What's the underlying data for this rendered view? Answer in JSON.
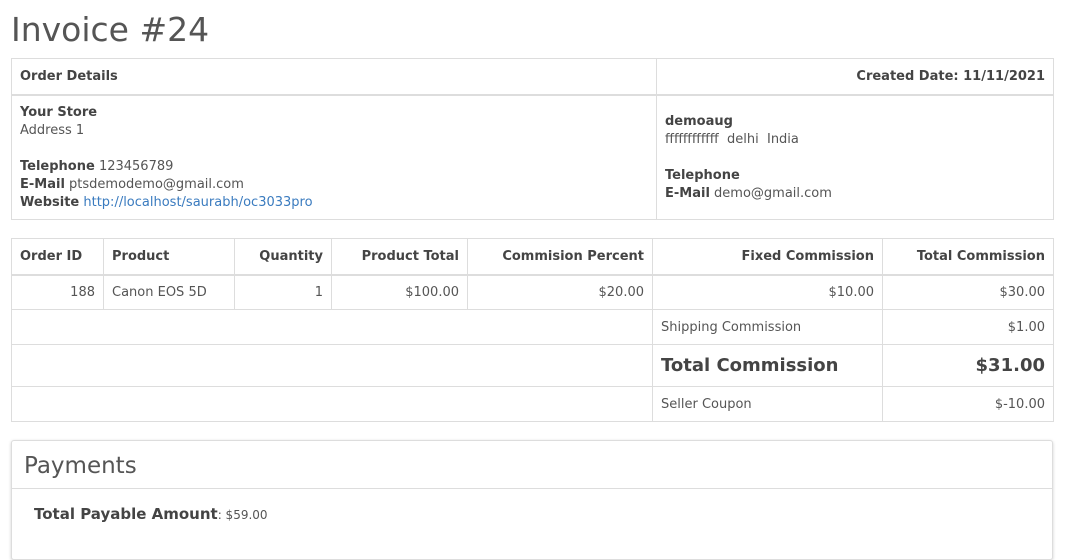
{
  "page": {
    "title": "Invoice #24"
  },
  "order_details": {
    "heading": "Order Details",
    "created_label": "Created Date:",
    "created_date": "11/11/2021",
    "store": {
      "name": "Your Store",
      "address": "Address 1",
      "telephone_label": "Telephone",
      "telephone": "123456789",
      "email_label": "E-Mail",
      "email": "ptsdemodemo@gmail.com",
      "website_label": "Website",
      "website": "http://localhost/saurabh/oc3033pro"
    },
    "customer": {
      "name": "demoaug",
      "address": "ffffffffffff  delhi  India",
      "telephone_label": "Telephone",
      "email_label": "E-Mail",
      "email": "demo@gmail.com"
    }
  },
  "order_table": {
    "headers": {
      "order_id": "Order ID",
      "product": "Product",
      "quantity": "Quantity",
      "product_total": "Product Total",
      "commission_percent": "Commision Percent",
      "fixed_commission": "Fixed Commission",
      "total_commission": "Total Commission"
    },
    "row": {
      "order_id": "188",
      "product": "Canon EOS 5D",
      "quantity": "1",
      "product_total": "$100.00",
      "commission_percent": "$20.00",
      "fixed_commission": "$10.00",
      "total_commission": "$30.00"
    },
    "shipping": {
      "label": "Shipping Commission",
      "value": "$1.00"
    },
    "total": {
      "label": "Total Commission",
      "value": "$31.00"
    },
    "coupon": {
      "label": "Seller Coupon",
      "value": "$-10.00"
    }
  },
  "payments": {
    "title": "Payments",
    "payable_label": "Total Payable Amount",
    "payable_value": ": $59.00"
  }
}
